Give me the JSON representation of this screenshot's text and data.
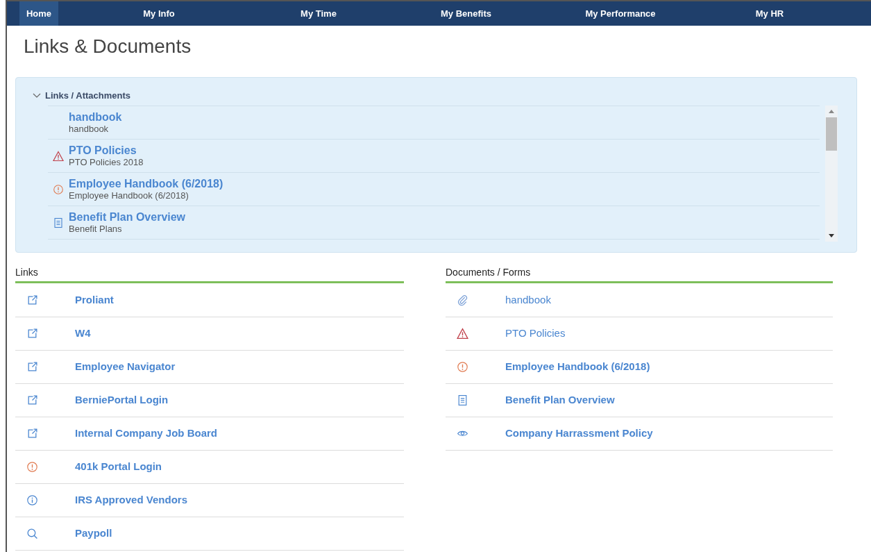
{
  "nav": [
    {
      "label": "Home",
      "selected": true
    },
    {
      "label": "My Info",
      "selected": false
    },
    {
      "label": "My Time",
      "selected": false
    },
    {
      "label": "My Benefits",
      "selected": false
    },
    {
      "label": "My Performance",
      "selected": false
    },
    {
      "label": "My HR",
      "selected": false
    }
  ],
  "title": "Links & Documents",
  "attachments": {
    "heading": "Links / Attachments",
    "expanded": true,
    "items": [
      {
        "kind": "plain",
        "title": "handbook",
        "subtitle": "handbook"
      },
      {
        "kind": "warning",
        "title": "PTO Policies",
        "subtitle": "PTO Policies 2018"
      },
      {
        "kind": "alert",
        "title": "Employee Handbook (6/2018)",
        "subtitle": "Employee Handbook (6/2018)"
      },
      {
        "kind": "document",
        "title": "Benefit Plan Overview",
        "subtitle": "Benefit Plans"
      }
    ]
  },
  "links": {
    "heading": "Links",
    "items": [
      {
        "kind": "external",
        "label": "Proliant",
        "bold": true
      },
      {
        "kind": "external",
        "label": "W4",
        "bold": true
      },
      {
        "kind": "external",
        "label": "Employee Navigator",
        "bold": true
      },
      {
        "kind": "external",
        "label": "BerniePortal Login",
        "bold": true
      },
      {
        "kind": "external",
        "label": "Internal Company Job Board",
        "bold": true
      },
      {
        "kind": "alert",
        "label": "401k Portal Login",
        "bold": true
      },
      {
        "kind": "info",
        "label": "IRS Approved Vendors",
        "bold": true
      },
      {
        "kind": "search",
        "label": "Paypoll",
        "bold": true
      }
    ]
  },
  "documents": {
    "heading": "Documents / Forms",
    "items": [
      {
        "kind": "attachment",
        "label": "handbook",
        "bold": false
      },
      {
        "kind": "warning",
        "label": "PTO Policies",
        "bold": false
      },
      {
        "kind": "alert",
        "label": "Employee Handbook (6/2018)",
        "bold": true
      },
      {
        "kind": "document",
        "label": "Benefit Plan Overview",
        "bold": true
      },
      {
        "kind": "view",
        "label": "Company Harrassment Policy",
        "bold": true
      }
    ]
  }
}
